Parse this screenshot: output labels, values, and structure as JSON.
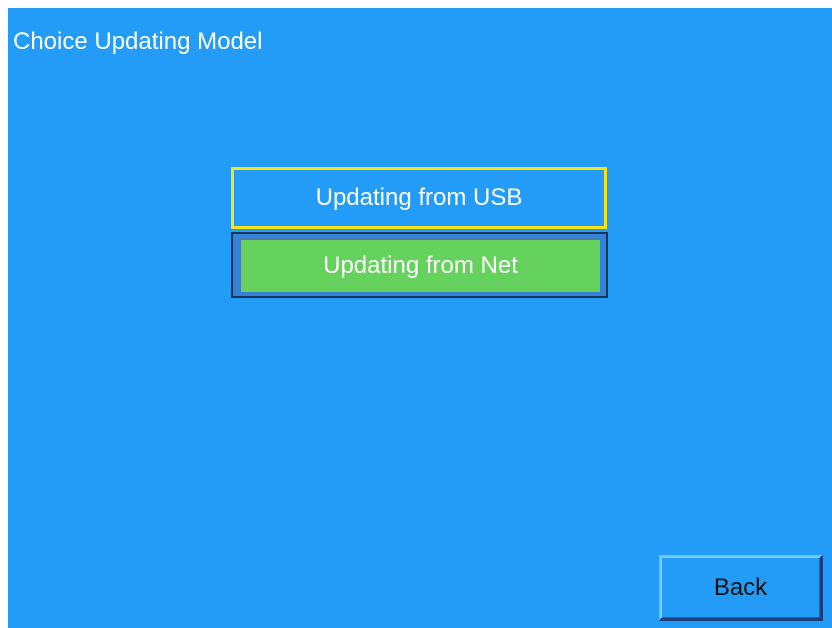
{
  "screen": {
    "title": "Choice Updating Model"
  },
  "menu": {
    "options": [
      {
        "label": "Updating from USB",
        "state": "focused"
      },
      {
        "label": "Updating from Net",
        "state": "selected"
      }
    ]
  },
  "footer": {
    "back_label": "Back"
  },
  "colors": {
    "background": "#229cf6",
    "focus_border": "#f5e21a",
    "selected_fill": "#66d25e"
  }
}
